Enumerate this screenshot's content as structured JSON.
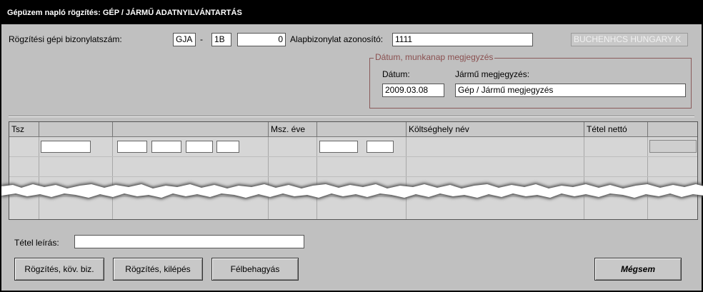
{
  "window": {
    "title": "Gépüzem napló rögzítés: GÉP / JÁRMŰ ADATNYILVÁNTARTÁS"
  },
  "header": {
    "doc_number_label": "Rögzítési gépi bizonylatszám:",
    "prefix": "GJA",
    "dash": "-",
    "series": "1B",
    "number": "0",
    "base_doc_label": "Alapbizonylat azonosító:",
    "base_doc_value": "1111",
    "company": "BUCHENHCS HUNGARY K"
  },
  "date_group": {
    "title": "Dátum, munkanap megjegyzés",
    "date_label": "Dátum:",
    "date_value": "2009.03.08",
    "note_label": "Jármű megjegyzés:",
    "note_value": "Gép / Jármű megjegyzés"
  },
  "grid": {
    "columns": [
      "Tsz",
      "",
      "",
      "Msz. éve",
      "",
      "Költséghely név",
      "Tétel nettó",
      ""
    ]
  },
  "item_desc": {
    "label": "Tétel leírás:",
    "value": ""
  },
  "buttons": {
    "save_next": "Rögzítés, köv. biz.",
    "save_exit": "Rögzítés, kilépés",
    "suspend": "Félbehagyás",
    "cancel": "Mégsem"
  }
}
